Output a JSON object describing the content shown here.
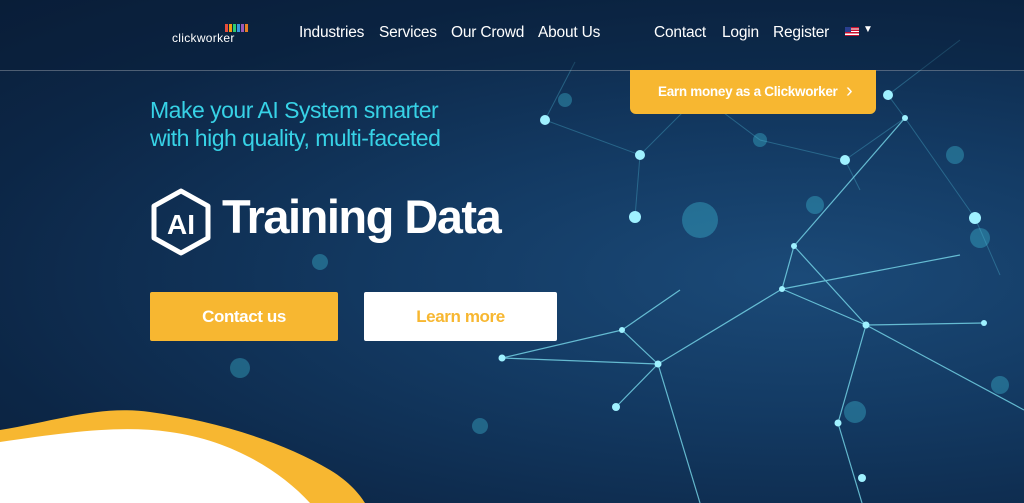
{
  "brand": {
    "logo_text": "clickworker",
    "logo_bar_colors": [
      "#e74c3c",
      "#f39c12",
      "#2ecc71",
      "#3498db",
      "#9b59b6",
      "#e67e22"
    ]
  },
  "nav": {
    "left_links": [
      "Industries",
      "Services",
      "Our Crowd",
      "About Us"
    ],
    "right_links": [
      "Contact",
      "Login",
      "Register"
    ],
    "language_flag": "us-flag-icon"
  },
  "earn": {
    "label": "Earn money as a Clickworker"
  },
  "hero": {
    "tagline_lines": [
      "Make your AI System smarter",
      "with high quality, multi-faceted"
    ],
    "badge_text": "AI",
    "title": "Training Data"
  },
  "buttons": {
    "contact": "Contact us",
    "learn": "Learn more"
  },
  "colors": {
    "accent_yellow": "#f7b731",
    "tagline_cyan": "#37d2e6",
    "background_navy": "#0d2541"
  }
}
